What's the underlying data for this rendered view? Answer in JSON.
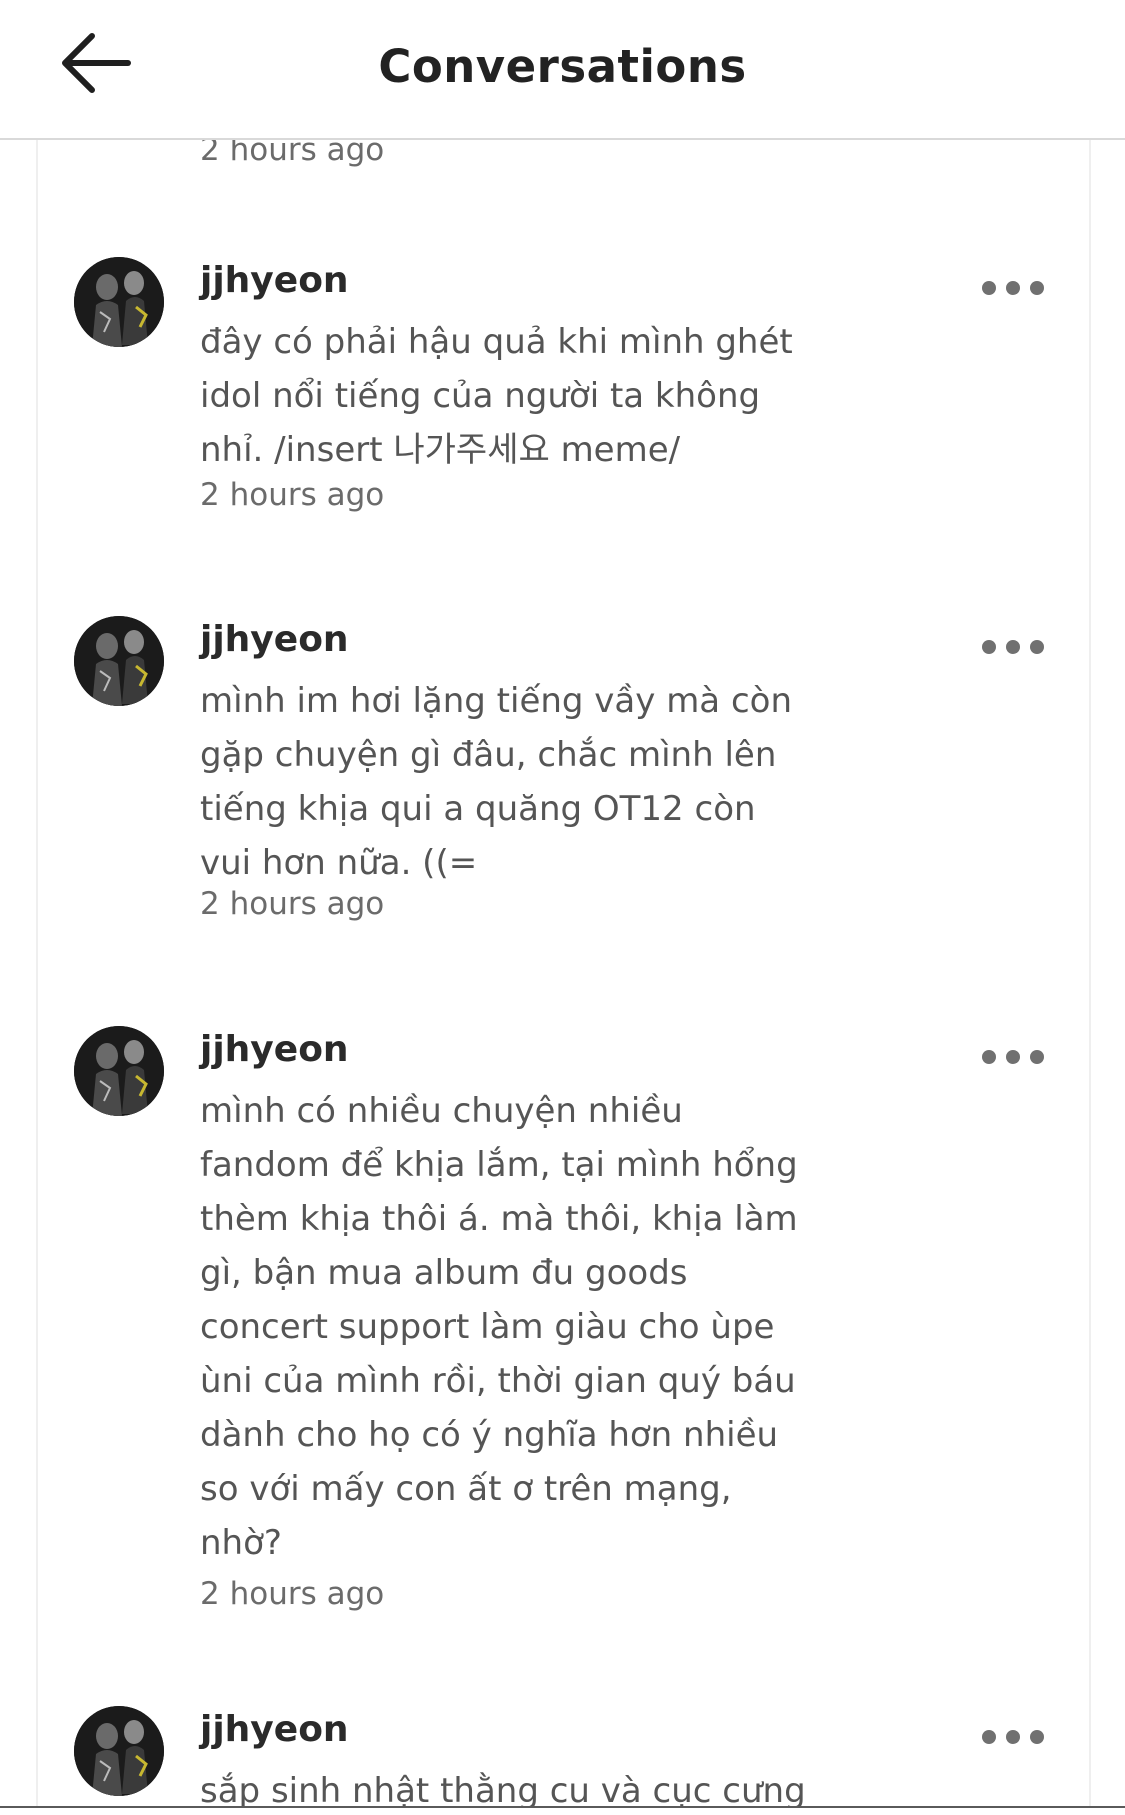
{
  "header": {
    "title": "Conversations",
    "back_icon": "arrow-left-icon"
  },
  "top_timestamp": "2 hours ago",
  "messages": [
    {
      "username": "jjhyeon",
      "text": "đây có phải hậu quả khi mình ghét\nidol nổi tiếng của người ta không\nnhỉ. /insert 나가주세요 meme/",
      "timestamp": "2 hours ago"
    },
    {
      "username": "jjhyeon",
      "text": "mình im hơi lặng tiếng vầy mà còn\ngặp chuyện gì đâu, chắc mình lên\ntiếng khịa qui a quăng OT12 còn\nvui hơn nữa. ((=",
      "timestamp": "2 hours ago"
    },
    {
      "username": "jjhyeon",
      "text": "mình có nhiều chuyện nhiều\nfandom để khịa lắm, tại mình hổng\nthèm khịa thôi á. mà thôi, khịa làm\ngì, bận mua album đu goods\nconcert support làm giàu cho ùpe\nùni của mình rồi, thời gian quý báu\ndành cho họ có ý nghĩa hơn nhiều\nso với mấy con ất ơ trên mạng,\nnhờ?",
      "timestamp": "2 hours ago"
    },
    {
      "username": "jjhyeon",
      "text": "sắp sinh nhật thằng cu và cục cưng",
      "timestamp": ""
    }
  ],
  "icons": {
    "avatar": "avatar-image",
    "more": "more-options-icon"
  },
  "colors": {
    "text_primary": "#222222",
    "text_secondary": "#555555",
    "timestamp": "#6b6b6b",
    "dots": "#707070"
  }
}
